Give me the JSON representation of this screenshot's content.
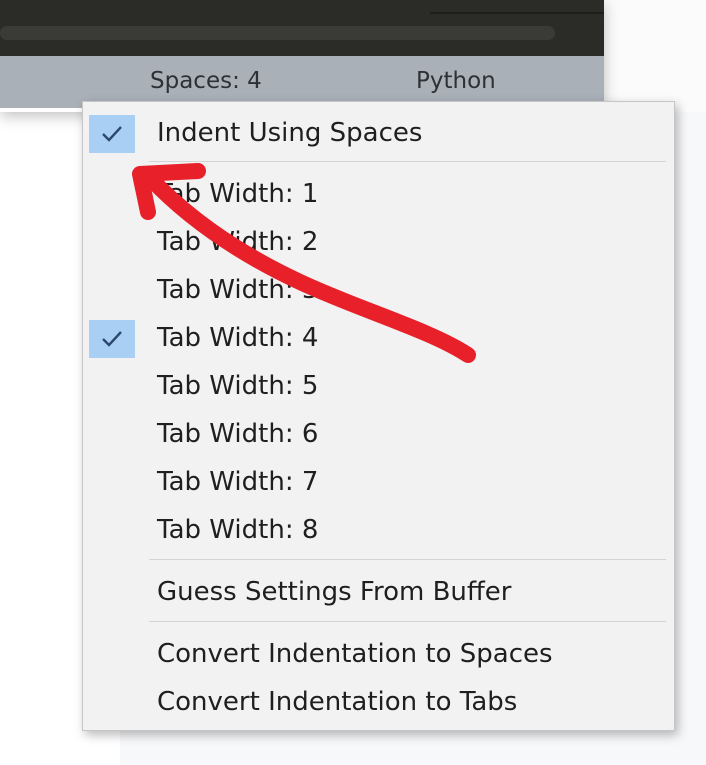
{
  "status_bar": {
    "indentation": "Spaces: 4",
    "syntax": "Python"
  },
  "menu": {
    "indent_using_spaces": {
      "label": "Indent Using Spaces",
      "checked": true
    },
    "tab_widths": [
      {
        "label": "Tab Width: 1",
        "checked": false
      },
      {
        "label": "Tab Width: 2",
        "checked": false
      },
      {
        "label": "Tab Width: 3",
        "checked": false
      },
      {
        "label": "Tab Width: 4",
        "checked": true
      },
      {
        "label": "Tab Width: 5",
        "checked": false
      },
      {
        "label": "Tab Width: 6",
        "checked": false
      },
      {
        "label": "Tab Width: 7",
        "checked": false
      },
      {
        "label": "Tab Width: 8",
        "checked": false
      }
    ],
    "guess_settings": "Guess Settings From Buffer",
    "convert_to_spaces": "Convert Indentation to Spaces",
    "convert_to_tabs": "Convert Indentation to Tabs"
  },
  "colors": {
    "check_highlight": "#a9cff5",
    "annotation_arrow": "#e8202a",
    "status_bar": "#a9b0b8",
    "editor_background": "#2b2b27"
  }
}
